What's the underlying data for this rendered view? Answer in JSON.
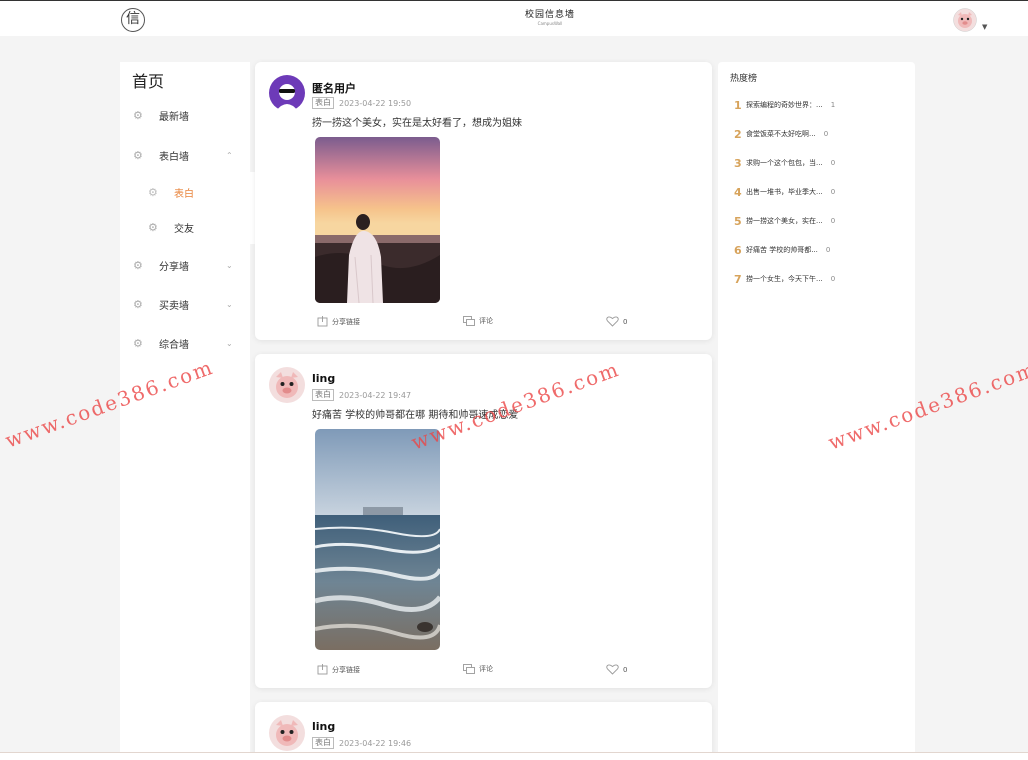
{
  "header": {
    "logo_char": "信",
    "brand_title": "校园信息墙",
    "brand_sub": "CampusWall"
  },
  "sidebar": {
    "title": "首页",
    "items": [
      {
        "label": "最新墙",
        "chevron": ""
      },
      {
        "label": "表白墙",
        "chevron": "⌃"
      },
      {
        "label": "表白",
        "chevron": ""
      },
      {
        "label": "交友",
        "chevron": ""
      },
      {
        "label": "分享墙",
        "chevron": "⌄"
      },
      {
        "label": "买卖墙",
        "chevron": "⌄"
      },
      {
        "label": "综合墙",
        "chevron": "⌄"
      }
    ]
  },
  "posts": [
    {
      "author": "匿名用户",
      "tag": "表白",
      "time": "2023-04-22 19:50",
      "content": "捞一捞这个美女，实在是太好看了，想成为姐妹",
      "share_label": "分享链接",
      "comment_label": "评论",
      "likes": "0"
    },
    {
      "author": "ling",
      "tag": "表白",
      "time": "2023-04-22 19:47",
      "content": "好痛苦 学校的帅哥都在哪 期待和帅哥速成恋爱",
      "share_label": "分享链接",
      "comment_label": "评论",
      "likes": "0"
    },
    {
      "author": "ling",
      "tag": "表白",
      "time": "2023-04-22 19:46"
    }
  ],
  "hot": {
    "title": "热度榜",
    "items": [
      {
        "rank": "1",
        "text": "探索编程的奇妙世界：...",
        "count": "1"
      },
      {
        "rank": "2",
        "text": "食堂饭菜不太好吃啊...",
        "count": "0"
      },
      {
        "rank": "3",
        "text": "求购一个这个包包，当...",
        "count": "0"
      },
      {
        "rank": "4",
        "text": "出售一堆书，毕业季大...",
        "count": "0"
      },
      {
        "rank": "5",
        "text": "捞一捞这个美女，实在...",
        "count": "0"
      },
      {
        "rank": "6",
        "text": "好痛苦 学校的帅哥都...",
        "count": "0"
      },
      {
        "rank": "7",
        "text": "捞一个女生，今天下午...",
        "count": "0"
      }
    ]
  },
  "watermark": "www.code386.com",
  "colors": {
    "accent": "#e8833a",
    "hot_rank": "#d7a35b",
    "watermark": "#eb4646"
  }
}
